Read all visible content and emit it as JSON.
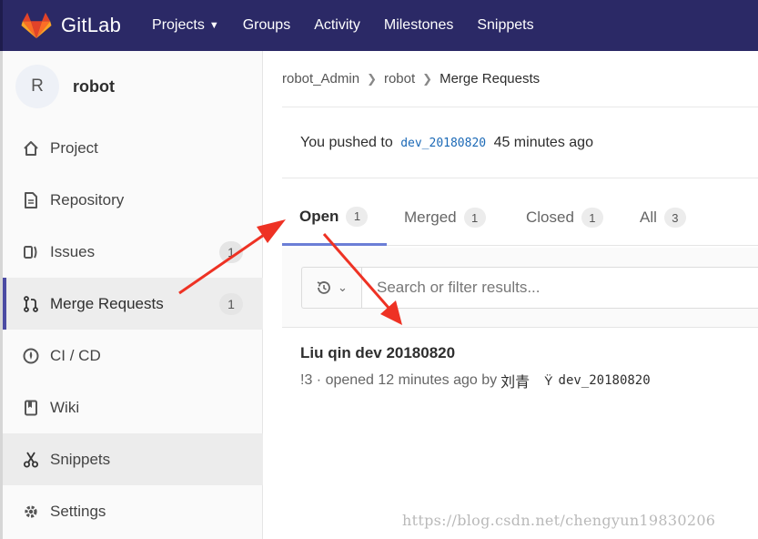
{
  "navbar": {
    "brand": "GitLab",
    "items": [
      {
        "label": "Projects",
        "has_caret": true
      },
      {
        "label": "Groups"
      },
      {
        "label": "Activity"
      },
      {
        "label": "Milestones"
      },
      {
        "label": "Snippets"
      }
    ],
    "colors": {
      "background": "#2b2966",
      "logo": "#e24329"
    }
  },
  "sidebar": {
    "avatar_letter": "R",
    "project_name": "robot",
    "items": [
      {
        "label": "Project",
        "icon": "home-icon"
      },
      {
        "label": "Repository",
        "icon": "document-icon"
      },
      {
        "label": "Issues",
        "icon": "issues-icon",
        "count": "1"
      },
      {
        "label": "Merge Requests",
        "icon": "merge-request-icon",
        "count": "1",
        "active": true
      },
      {
        "label": "CI / CD",
        "icon": "rocket-icon"
      },
      {
        "label": "Wiki",
        "icon": "book-icon"
      },
      {
        "label": "Snippets",
        "icon": "scissors-icon"
      },
      {
        "label": "Settings",
        "icon": "gear-icon"
      }
    ]
  },
  "breadcrumb": {
    "items": [
      "robot_Admin",
      "robot",
      "Merge Requests"
    ]
  },
  "push_note": {
    "prefix": "You pushed to",
    "branch": "dev_20180820",
    "suffix": "45 minutes ago"
  },
  "tabs": [
    {
      "label": "Open",
      "count": "1",
      "active": true
    },
    {
      "label": "Merged",
      "count": "1"
    },
    {
      "label": "Closed",
      "count": "1"
    },
    {
      "label": "All",
      "count": "3"
    }
  ],
  "filter": {
    "placeholder": "Search or filter results..."
  },
  "merge_request": {
    "title": "Liu qin dev 20180820",
    "meta": "!3 · opened 12 minutes ago by",
    "author": "刘青",
    "branch": "dev_20180820"
  },
  "annotations": {
    "arrow_color": "#ee3224"
  },
  "watermark": "https://blog.csdn.net/chengyun19830206"
}
